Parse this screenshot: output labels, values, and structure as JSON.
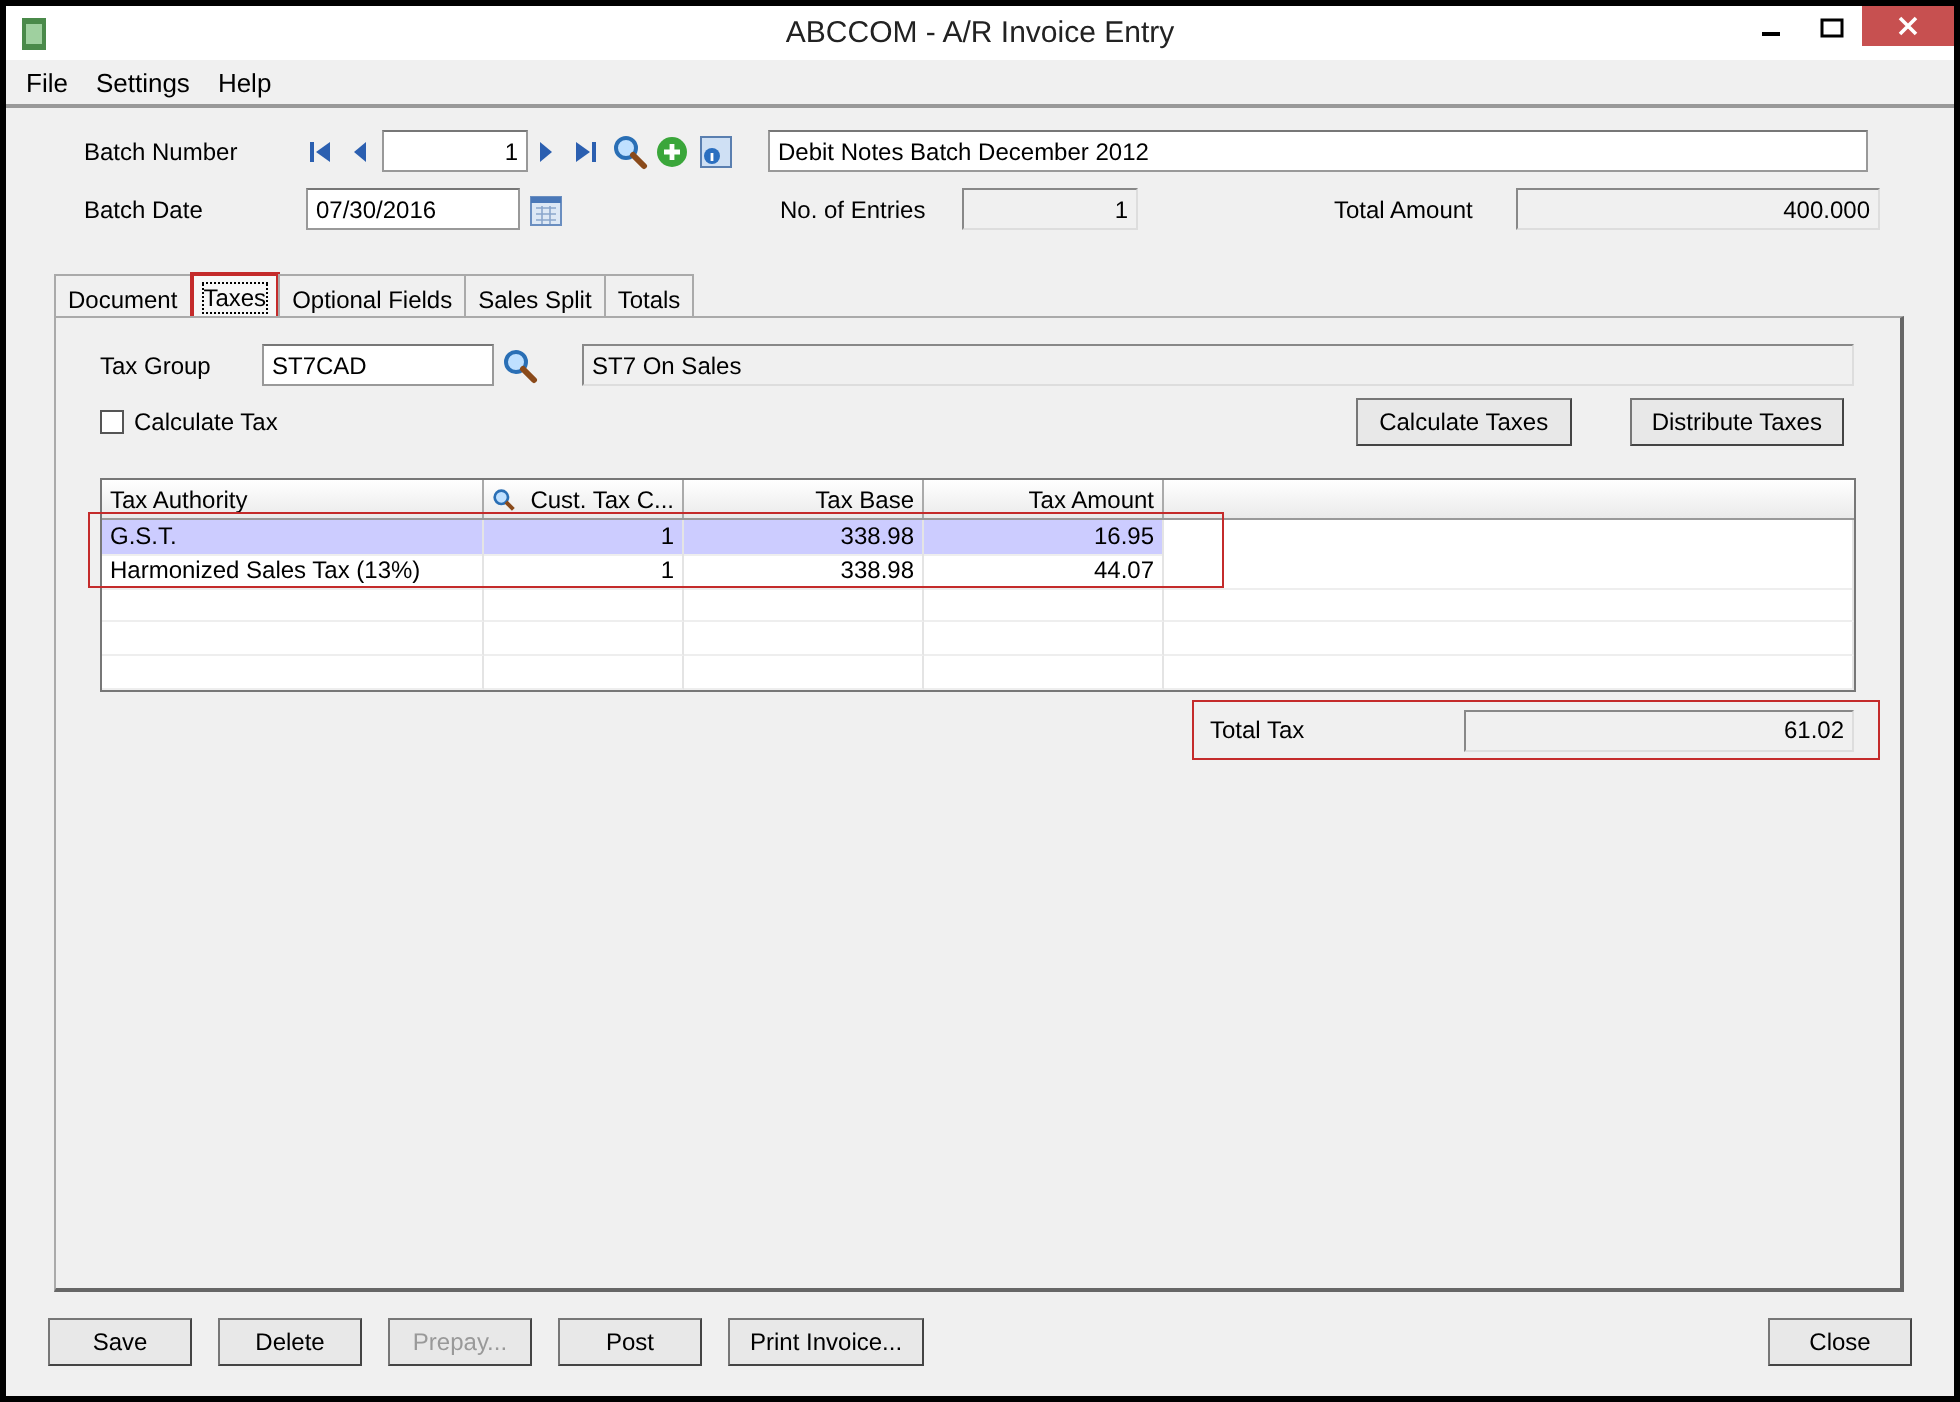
{
  "window": {
    "title": "ABCCOM - A/R Invoice Entry"
  },
  "menu": [
    "File",
    "Settings",
    "Help"
  ],
  "batch": {
    "number_label": "Batch Number",
    "number": "1",
    "description": "Debit Notes Batch December 2012",
    "date_label": "Batch Date",
    "date": "07/30/2016",
    "entries_label": "No. of Entries",
    "entries": "1",
    "total_label": "Total Amount",
    "total": "400.000"
  },
  "tabs": [
    {
      "label": "Document",
      "selected": false
    },
    {
      "label": "Taxes",
      "selected": true
    },
    {
      "label": "Optional Fields",
      "selected": false
    },
    {
      "label": "Sales Split",
      "selected": false
    },
    {
      "label": "Totals",
      "selected": false
    }
  ],
  "tax_group": {
    "label": "Tax Group",
    "value": "ST7CAD",
    "description": "ST7 On Sales"
  },
  "calculate_tax": {
    "label": "Calculate Tax",
    "checked": false
  },
  "actions": [
    "Calculate Taxes",
    "Distribute Taxes"
  ],
  "table": {
    "columns": [
      "Tax Authority",
      "Cust. Tax C...",
      "Tax Base",
      "Tax Amount"
    ],
    "highlighted": true,
    "rows": [
      {
        "cells": [
          "G.S.T.",
          "1",
          "338.98",
          "16.95"
        ],
        "selected": true
      },
      {
        "cells": [
          "Harmonized Sales Tax (13%)",
          "1",
          "338.98",
          "44.07"
        ],
        "selected": false
      }
    ]
  },
  "total_tax": {
    "label": "Total Tax",
    "value": "61.02",
    "highlighted": true
  },
  "buttons": [
    {
      "label": "Save",
      "disabled": false
    },
    {
      "label": "Delete",
      "disabled": false
    },
    {
      "label": "Prepay...",
      "disabled": true
    },
    {
      "label": "Post",
      "disabled": false
    },
    {
      "label": "Print Invoice...",
      "disabled": false
    }
  ],
  "close_button": "Close"
}
